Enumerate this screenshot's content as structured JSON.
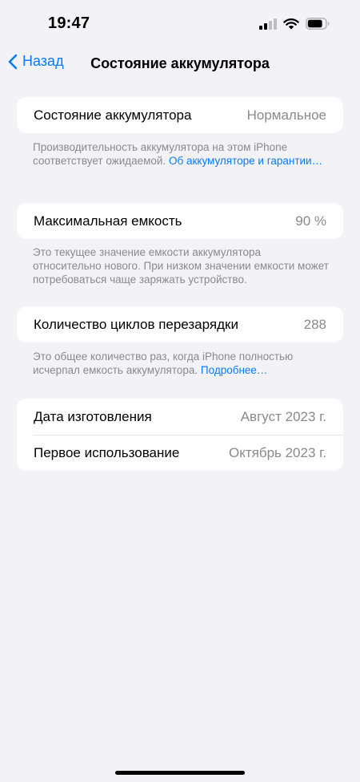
{
  "status_bar": {
    "time": "19:47",
    "icons": [
      "cellular-signal-icon",
      "wifi-icon",
      "battery-icon"
    ],
    "signal_bars_active": 2,
    "signal_bars_total": 4,
    "battery_level": 0.85
  },
  "nav": {
    "back_label": "Назад",
    "title": "Состояние аккумулятора"
  },
  "sections": {
    "battery_health": {
      "label": "Состояние аккумулятора",
      "value": "Нормальное",
      "footer_text": "Производительность аккумулятора на этом iPhone соответствует ожидаемой. ",
      "footer_link": "Об аккумуляторе и гарантии…"
    },
    "max_capacity": {
      "label": "Максимальная емкость",
      "value": "90 %",
      "footer_text": "Это текущее значение емкости аккумулятора относительно нового. При низком значении емкости может потребоваться чаще заряжать устройство."
    },
    "cycle_count": {
      "label": "Количество циклов перезарядки",
      "value": "288",
      "footer_text": "Это общее количество раз, когда iPhone полностью исчерпал емкость аккумулятора. ",
      "footer_link": "Подробнее…"
    },
    "dates": {
      "manufacture_label": "Дата изготовления",
      "manufacture_value": "Август 2023 г.",
      "first_use_label": "Первое использование",
      "first_use_value": "Октябрь 2023 г."
    }
  },
  "colors": {
    "background": "#f2f2f7",
    "accent": "#0a7aff",
    "secondary_text": "#8a8a8e"
  }
}
